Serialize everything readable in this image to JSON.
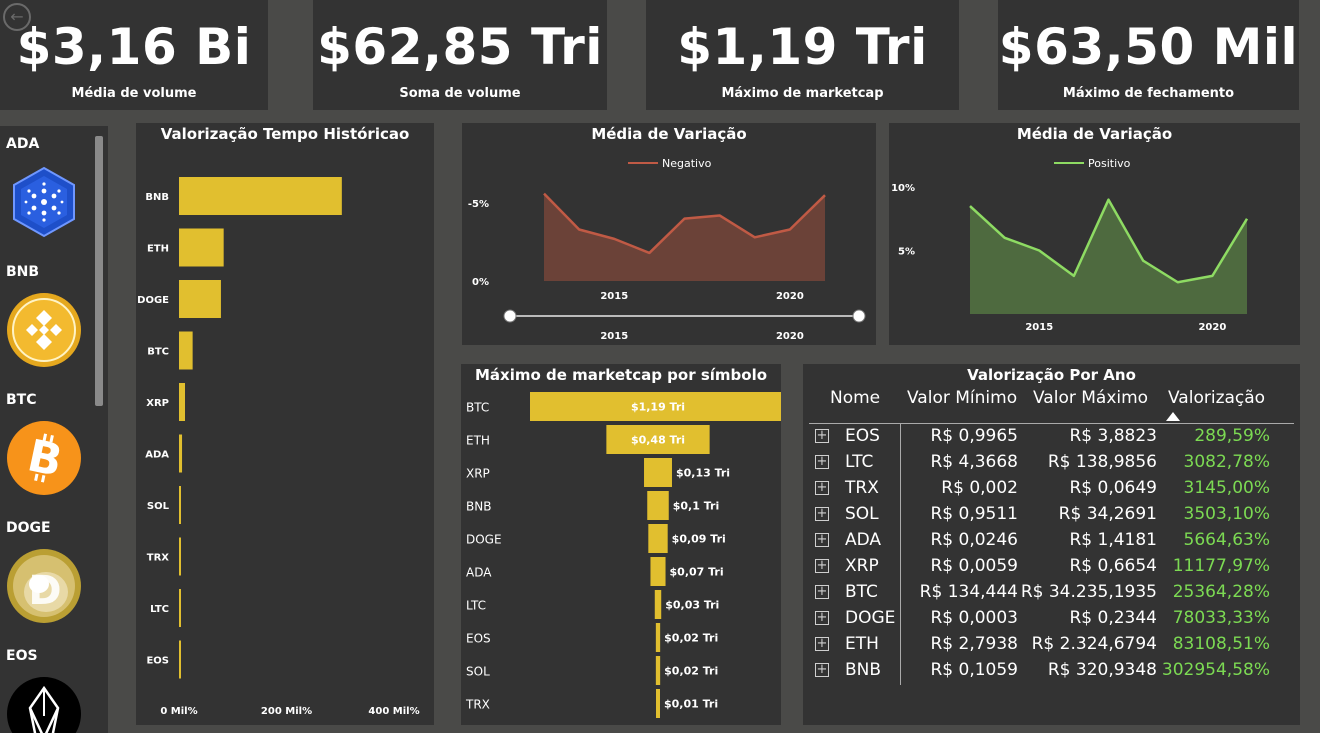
{
  "kpis": [
    {
      "value": "$3,16 Bi",
      "label": "Média de volume"
    },
    {
      "value": "$62,85 Tri",
      "label": "Soma de volume"
    },
    {
      "value": "$1,19 Tri",
      "label": "Máximo de marketcap"
    },
    {
      "value": "$63,50 Mil",
      "label": "Máximo de fechamento"
    }
  ],
  "sidebar": {
    "items": [
      {
        "label": "ADA",
        "icon": "cardano-logo-icon",
        "color": "#1E4FC9"
      },
      {
        "label": "BNB",
        "icon": "binance-logo-icon",
        "color": "#F3BA2F"
      },
      {
        "label": "BTC",
        "icon": "bitcoin-logo-icon",
        "color": "#F7931A"
      },
      {
        "label": "DOGE",
        "icon": "dogecoin-logo-icon",
        "color": "#C3A634"
      },
      {
        "label": "EOS",
        "icon": "eos-logo-icon",
        "color": "#000000"
      }
    ]
  },
  "chart_data": [
    {
      "type": "bar",
      "orientation": "horizontal",
      "title": "Valorização Tempo Históricao",
      "categories": [
        "BNB",
        "ETH",
        "DOGE",
        "BTC",
        "XRP",
        "ADA",
        "SOL",
        "TRX",
        "LTC",
        "EOS"
      ],
      "values": [
        302954.58,
        83108.51,
        78033.33,
        25364.28,
        11177.97,
        5664.63,
        3503.1,
        3145.0,
        3082.78,
        289.59
      ],
      "xticks": [
        "0 Mil%",
        "200 Mil%",
        "400 Mil%"
      ],
      "xlim": [
        0,
        400000
      ],
      "color": "#E1BF2F"
    },
    {
      "type": "area",
      "title": "Média de Variação",
      "legend": [
        "Negativo"
      ],
      "legend_position": "top-center",
      "x": [
        2013,
        2014,
        2015,
        2016,
        2017,
        2018,
        2019,
        2020,
        2021
      ],
      "values": [
        -5.6,
        -3.3,
        -2.7,
        -1.8,
        -4.0,
        -4.2,
        -2.8,
        -3.3,
        -5.5
      ],
      "yticks": [
        "-5%",
        "0%"
      ],
      "xticks": [
        "2015",
        "2020"
      ],
      "slider_ticks": [
        "2015",
        "2020"
      ],
      "color": "#C05A45",
      "fill": "#6B4238"
    },
    {
      "type": "area",
      "title": "Média de Variação",
      "legend": [
        "Positivo"
      ],
      "legend_position": "top-center",
      "x": [
        2013,
        2014,
        2015,
        2016,
        2017,
        2018,
        2019,
        2020,
        2021
      ],
      "values": [
        8.5,
        6.0,
        5.0,
        3.0,
        9.0,
        4.2,
        2.5,
        3.0,
        7.5
      ],
      "yticks": [
        "10%",
        "5%"
      ],
      "xticks": [
        "2015",
        "2020"
      ],
      "color": "#8EDB63",
      "fill": "#4E6A3F"
    },
    {
      "type": "bar",
      "orientation": "horizontal-funnel",
      "title": "Máximo de marketcap por símbolo",
      "categories": [
        "BTC",
        "ETH",
        "XRP",
        "BNB",
        "DOGE",
        "ADA",
        "LTC",
        "EOS",
        "SOL",
        "TRX"
      ],
      "values": [
        1.19,
        0.48,
        0.13,
        0.1,
        0.09,
        0.07,
        0.03,
        0.02,
        0.02,
        0.01
      ],
      "labels": [
        "$1,19 Tri",
        "$0,48 Tri",
        "$0,13 Tri",
        "$0,1 Tri",
        "$0,09 Tri",
        "$0,07 Tri",
        "$0,03 Tri",
        "$0,02 Tri",
        "$0,02 Tri",
        "$0,01 Tri"
      ],
      "color": "#E1BF2F"
    }
  ],
  "table": {
    "title": "Valorização Por Ano",
    "headers": [
      "Nome",
      "Valor Mínimo",
      "Valor Máximo",
      "Valorização"
    ],
    "rows": [
      {
        "name": "EOS",
        "min": "R$ 0,9965",
        "max": "R$ 3,8823",
        "val": "289,59%"
      },
      {
        "name": "LTC",
        "min": "R$ 4,3668",
        "max": "R$ 138,9856",
        "val": "3082,78%"
      },
      {
        "name": "TRX",
        "min": "R$ 0,002",
        "max": "R$ 0,0649",
        "val": "3145,00%"
      },
      {
        "name": "SOL",
        "min": "R$ 0,9511",
        "max": "R$ 34,2691",
        "val": "3503,10%"
      },
      {
        "name": "ADA",
        "min": "R$ 0,0246",
        "max": "R$ 1,4181",
        "val": "5664,63%"
      },
      {
        "name": "XRP",
        "min": "R$ 0,0059",
        "max": "R$ 0,6654",
        "val": "11177,97%"
      },
      {
        "name": "BTC",
        "min": "R$ 134,444",
        "max": "R$ 34.235,1935",
        "val": "25364,28%"
      },
      {
        "name": "DOGE",
        "min": "R$ 0,0003",
        "max": "R$ 0,2344",
        "val": "78033,33%"
      },
      {
        "name": "ETH",
        "min": "R$ 2,7938",
        "max": "R$ 2.324,6794",
        "val": "83108,51%"
      },
      {
        "name": "BNB",
        "min": "R$ 0,1059",
        "max": "R$ 320,9348",
        "val": "302954,58%"
      }
    ]
  }
}
